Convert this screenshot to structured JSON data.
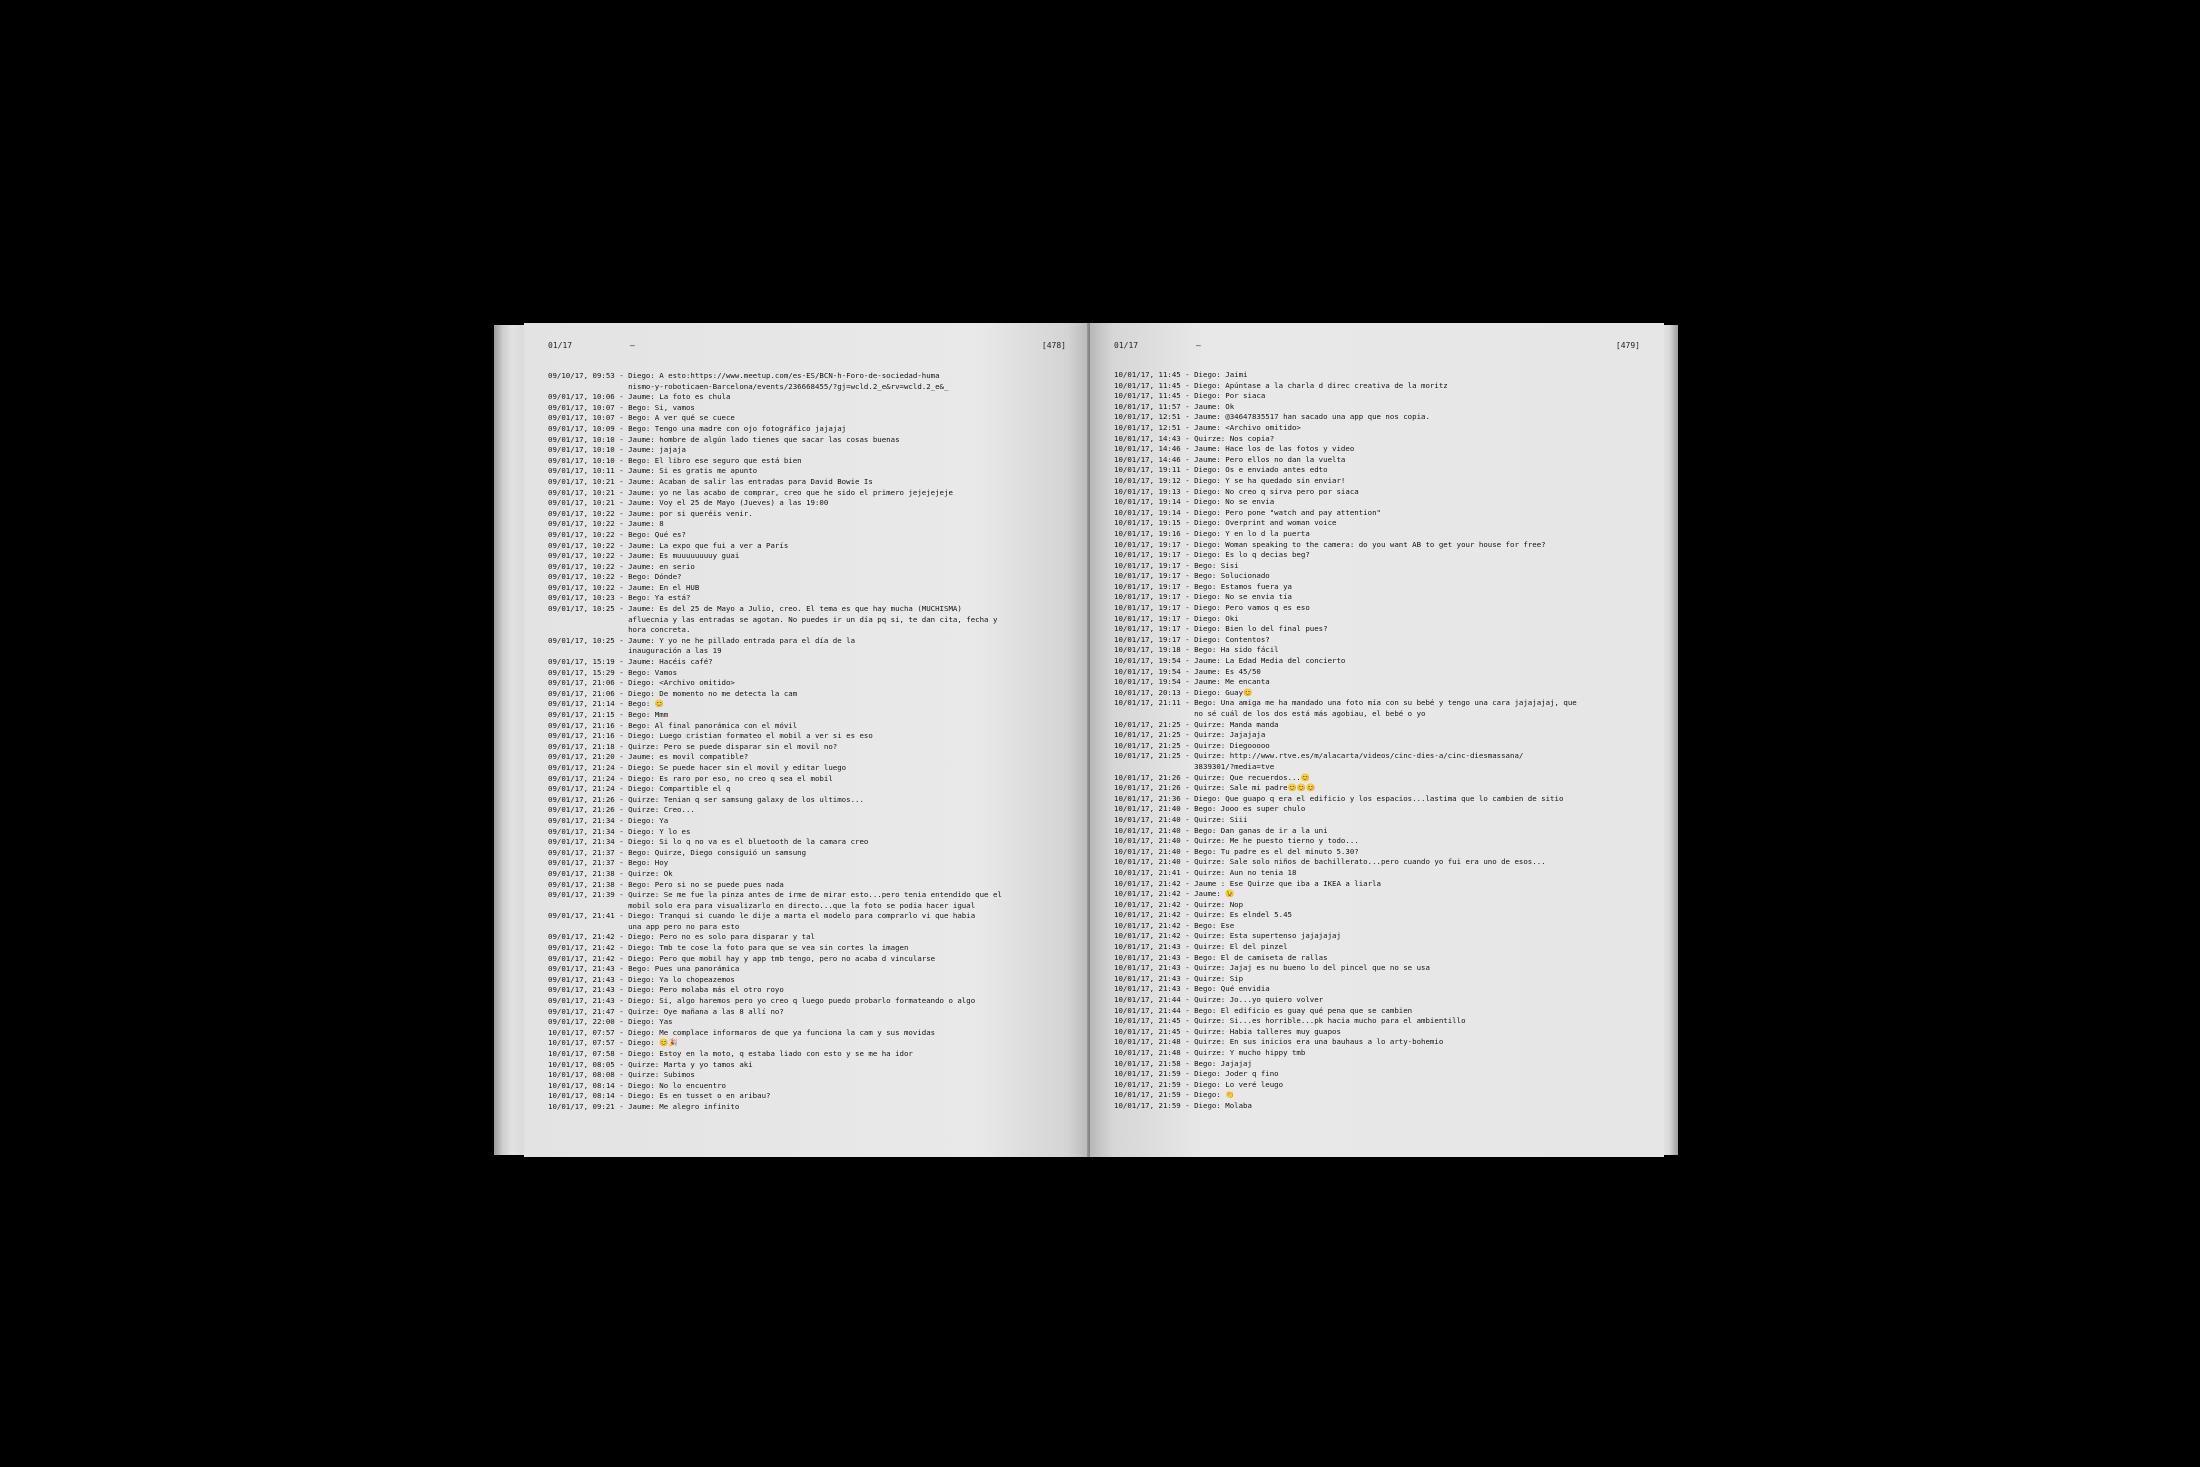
{
  "left_page": {
    "header": {
      "date": "01/17",
      "dash": "–",
      "page_number": "[478]"
    },
    "lines": [
      {
        "ts": "09/10/17, 09:53 - ",
        "msg": "Diego: A esto:https://www.meetup.com/es-ES/BCN-h-Foro-de-sociedad-huma\nnismo-y-roboticaen-Barcelona/events/236668455/?gj=wcld.2_e&rv=wcld.2_e&_"
      },
      {
        "ts": "09/01/17, 10:06 - ",
        "msg": "Jaume: La foto es chula"
      },
      {
        "ts": "09/01/17, 10:07 - ",
        "msg": "Bego: Si, vamos"
      },
      {
        "ts": "09/01/17, 10:07 - ",
        "msg": "Bego: A ver qué se cuece"
      },
      {
        "ts": "09/01/17, 10:09 - ",
        "msg": "Bego: Tengo una madre con ojo fotográfico jajajaj"
      },
      {
        "ts": "09/01/17, 10:10 - ",
        "msg": "Jaume: hombre de algún lado tienes que sacar las cosas buenas"
      },
      {
        "ts": "09/01/17, 10:10 - ",
        "msg": "Jaume: jajaja"
      },
      {
        "ts": "09/01/17, 10:10 - ",
        "msg": "Bego: El libro ese seguro que está bien"
      },
      {
        "ts": "09/01/17, 10:11 - ",
        "msg": "Jaume: Si es gratis me apunto"
      },
      {
        "ts": "09/01/17, 10:21 - ",
        "msg": "Jaume: Acaban de salir las entradas para David Bowie Is"
      },
      {
        "ts": "09/01/17, 10:21 - ",
        "msg": "Jaume: yo ne las acabo de comprar, creo que he sido el primero jejejejeje"
      },
      {
        "ts": "09/01/17, 10:21 - ",
        "msg": "Jaume: Voy el 25 de Mayo (Jueves) a las 19:00"
      },
      {
        "ts": "09/01/17, 10:22 - ",
        "msg": "Jaume: por si queréis venir."
      },
      {
        "ts": "09/01/17, 10:22 - ",
        "msg": "Jaume: 8"
      },
      {
        "ts": "09/01/17, 10:22 - ",
        "msg": "Bego: Qué es?"
      },
      {
        "ts": "09/01/17, 10:22 - ",
        "msg": "Jaume: La expo que fui a ver a París"
      },
      {
        "ts": "09/01/17, 10:22 - ",
        "msg": "Jaume: Es muuuuuuuuy guai"
      },
      {
        "ts": "09/01/17, 10:22 - ",
        "msg": "Jaume: en serio"
      },
      {
        "ts": "09/01/17, 10:22 - ",
        "msg": "Bego: Dónde?"
      },
      {
        "ts": "09/01/17, 10:22 - ",
        "msg": "Jaume: En el HUB"
      },
      {
        "ts": "09/01/17, 10:23 - ",
        "msg": "Bego: Ya está?"
      },
      {
        "ts": "09/01/17, 10:25 - ",
        "msg": "Jaume: Es del 25 de Mayo a Julio, creo. El tema es que hay mucha (MUCHISMA)\nafluecnia y las entradas se agotan. No puedes ir un día pq si, te dan cita, fecha y\nhora concreta."
      },
      {
        "ts": "09/01/17, 10:25 - ",
        "msg": "Jaume: Y yo ne he pillado entrada para el día de la\ninauguración a las 19"
      },
      {
        "ts": "09/01/17, 15:19 - ",
        "msg": "Jaume: Hacéis café?"
      },
      {
        "ts": "09/01/17, 15:29 - ",
        "msg": "Bego: Vamos"
      },
      {
        "ts": "09/01/17, 21:06 - ",
        "msg": "Diego: <Archivo omitido>"
      },
      {
        "ts": "09/01/17, 21:06 - ",
        "msg": "Diego: De momento no me detecta la cam"
      },
      {
        "ts": "09/01/17, 21:14 - ",
        "msg": "Bego: 😊"
      },
      {
        "ts": "09/01/17, 21:15 - ",
        "msg": "Bego: Mmm"
      },
      {
        "ts": "09/01/17, 21:16 - ",
        "msg": "Bego: Al final panorámica con el móvil"
      },
      {
        "ts": "09/01/17, 21:16 - ",
        "msg": "Diego: Luego cristian formateo el mobil a ver si es eso"
      },
      {
        "ts": "09/01/17, 21:18 - ",
        "msg": "Quirze: Pero se puede disparar sin el movil no?"
      },
      {
        "ts": "09/01/17, 21:20 - ",
        "msg": "Jaume: es movil compatible?"
      },
      {
        "ts": "09/01/17, 21:24 - ",
        "msg": "Diego: Se puede hacer sin el movil y editar luego"
      },
      {
        "ts": "09/01/17, 21:24 - ",
        "msg": "Diego: Es raro por eso, no creo q sea el mobil"
      },
      {
        "ts": "09/01/17, 21:24 - ",
        "msg": "Diego: Compartible el q"
      },
      {
        "ts": "09/01/17, 21:26 - ",
        "msg": "Quirze: Tenian q ser samsung galaxy de los ultimos..."
      },
      {
        "ts": "09/01/17, 21:26 - ",
        "msg": "Quirze: Creo..."
      },
      {
        "ts": "09/01/17, 21:34 - ",
        "msg": "Diego: Ya"
      },
      {
        "ts": "09/01/17, 21:34 - ",
        "msg": "Diego: Y lo es"
      },
      {
        "ts": "09/01/17, 21:34 - ",
        "msg": "Diego: Si lo q no va es el bluetooth de la camara creo"
      },
      {
        "ts": "09/01/17, 21:37 - ",
        "msg": "Bego: Quirze, Diego consiguió un samsung"
      },
      {
        "ts": "09/01/17, 21:37 - ",
        "msg": "Bego: Hoy"
      },
      {
        "ts": "09/01/17, 21:38 - ",
        "msg": "Quirze: Ok"
      },
      {
        "ts": "09/01/17, 21:38 - ",
        "msg": "Bego: Pero si no se puede pues nada"
      },
      {
        "ts": "09/01/17, 21:39 - ",
        "msg": "Quirze: Se me fue la pinza antes de irme de mirar esto...pero tenia entendido que el\nmobil solo era para visualizarlo en directo...que la foto se podia hacer igual"
      },
      {
        "ts": "09/01/17, 21:41 - ",
        "msg": "Diego: Tranqui si cuando le dije a marta el modelo para comprarlo vi que habia\nuna app pero no para esto"
      },
      {
        "ts": "09/01/17, 21:42 - ",
        "msg": "Diego: Pero no es solo para disparar y tal"
      },
      {
        "ts": "09/01/17, 21:42 - ",
        "msg": "Diego: Tmb te cose la foto para que se vea sin cortes la imagen"
      },
      {
        "ts": "09/01/17, 21:42 - ",
        "msg": "Diego: Pero que mobil hay y app tmb tengo, pero no acaba d vincularse"
      },
      {
        "ts": "09/01/17, 21:43 - ",
        "msg": "Bego: Pues una panorámica"
      },
      {
        "ts": "09/01/17, 21:43 - ",
        "msg": "Diego: Ya lo chopeazemos"
      },
      {
        "ts": "09/01/17, 21:43 - ",
        "msg": "Diego: Pero molaba más el otro royo"
      },
      {
        "ts": "09/01/17, 21:43 - ",
        "msg": "Diego: Si, algo haremos pero yo creo q luego puedo probarlo formateando o algo"
      },
      {
        "ts": "09/01/17, 21:47 - ",
        "msg": "Quirze: Oye mañana a las 8 allí no?"
      },
      {
        "ts": "09/01/17, 22:00 - ",
        "msg": "Diego: Yas"
      },
      {
        "ts": "10/01/17, 07:57 - ",
        "msg": "Diego: Me complace informaros de que ya funciona la cam y sus movidas"
      },
      {
        "ts": "10/01/17, 07:57 - ",
        "msg": "Diego: 😊🎉"
      },
      {
        "ts": "10/01/17, 07:58 - ",
        "msg": "Diego: Estoy en la moto, q estaba liado con esto y se me ha idor"
      },
      {
        "ts": "10/01/17, 08:05 - ",
        "msg": "Quirze: Marta y yo tamos aki"
      },
      {
        "ts": "10/01/17, 08:08 - ",
        "msg": "Quirze: Subimos"
      },
      {
        "ts": "10/01/17, 08:14 - ",
        "msg": "Diego: No lo encuentro"
      },
      {
        "ts": "10/01/17, 08:14 - ",
        "msg": "Diego: Es en tusset o en aribau?"
      },
      {
        "ts": "10/01/17, 09:21 - ",
        "msg": "Jaume: Me alegro infinito"
      }
    ]
  },
  "right_page": {
    "header": {
      "date": "01/17",
      "dash": "–",
      "page_number": "[479]"
    },
    "lines": [
      {
        "ts": "10/01/17, 11:45 - ",
        "msg": "Diego: Jaimi"
      },
      {
        "ts": "10/01/17, 11:45 - ",
        "msg": "Diego: Apúntase a la charla d direc creativa de la moritz"
      },
      {
        "ts": "10/01/17, 11:45 - ",
        "msg": "Diego: Por siaca"
      },
      {
        "ts": "10/01/17, 11:57 - ",
        "msg": "Jaume: Ok"
      },
      {
        "ts": "10/01/17, 12:51 - ",
        "msg": "Jaume: @34647835517 han sacado una app que nos copia."
      },
      {
        "ts": "10/01/17, 12:51 - ",
        "msg": "Jaume: <Archivo omitido>"
      },
      {
        "ts": "10/01/17, 14:43 - ",
        "msg": "Quirze: Nos copia?"
      },
      {
        "ts": "10/01/17, 14:46 - ",
        "msg": "Jaume: Hace los de las fotos y video"
      },
      {
        "ts": "10/01/17, 14:46 - ",
        "msg": "Jaume: Pero ellos no dan la vuelta"
      },
      {
        "ts": "10/01/17, 19:11 - ",
        "msg": "Diego: Os e enviado antes edto"
      },
      {
        "ts": "10/01/17, 19:12 - ",
        "msg": "Diego: Y se ha quedado sin enviar!"
      },
      {
        "ts": "10/01/17, 19:13 - ",
        "msg": "Diego: No creo q sirva pero por siaca"
      },
      {
        "ts": "10/01/17, 19:14 - ",
        "msg": "Diego: No se envia"
      },
      {
        "ts": "10/01/17, 19:14 - ",
        "msg": "Diego: Pero pone \"watch and pay attention\""
      },
      {
        "ts": "10/01/17, 19:15 - ",
        "msg": "Diego: Overprint and woman voice"
      },
      {
        "ts": "10/01/17, 19:16 - ",
        "msg": "Diego: Y en lo d la puerta"
      },
      {
        "ts": "10/01/17, 19:17 - ",
        "msg": "Diego: Woman speaking to the camera: do you want AB to get your house for free?"
      },
      {
        "ts": "10/01/17, 19:17 - ",
        "msg": "Diego: Es lo q decias beg?"
      },
      {
        "ts": "10/01/17, 19:17 - ",
        "msg": "Bego: Sisi"
      },
      {
        "ts": "10/01/17, 19:17 - ",
        "msg": "Bego: Solucionado"
      },
      {
        "ts": "10/01/17, 19:17 - ",
        "msg": "Bego: Estamos fuera ya"
      },
      {
        "ts": "10/01/17, 19:17 - ",
        "msg": "Diego: No se envia tía"
      },
      {
        "ts": "10/01/17, 19:17 - ",
        "msg": "Diego: Pero vamos q es eso"
      },
      {
        "ts": "10/01/17, 19:17 - ",
        "msg": "Diego: Oki"
      },
      {
        "ts": "10/01/17, 19:17 - ",
        "msg": "Diego: Bien lo del final pues?"
      },
      {
        "ts": "10/01/17, 19:17 - ",
        "msg": "Diego: Contentos?"
      },
      {
        "ts": "10/01/17, 19:18 - ",
        "msg": "Bego: Ha sido fácil"
      },
      {
        "ts": "10/01/17, 19:54 - ",
        "msg": "Jaume: La Edad Media del concierto"
      },
      {
        "ts": "10/01/17, 19:54 - ",
        "msg": "Jaume: Es 45/50"
      },
      {
        "ts": "10/01/17, 19:54 - ",
        "msg": "Jaume: Me encanta"
      },
      {
        "ts": "10/01/17, 20:13 - ",
        "msg": "Diego: Guay😊"
      },
      {
        "ts": "10/01/17, 21:11 - ",
        "msg": "Bego: Una amiga me ha mandado una foto mía con su bebé y tengo una cara jajajajaj, que\nno sé cuál de los dos está más agobiau, el bebé o yo"
      },
      {
        "ts": "10/01/17, 21:25 - ",
        "msg": "Quirze: Manda manda"
      },
      {
        "ts": "10/01/17, 21:25 - ",
        "msg": "Quirze: Jajajaja"
      },
      {
        "ts": "10/01/17, 21:25 - ",
        "msg": "Quirze: Diegooooo"
      },
      {
        "ts": "10/01/17, 21:25 - ",
        "msg": "Quirze: http://www.rtve.es/m/alacarta/videos/cinc-dies-a/cinc-diesmassana/\n3839301/?media=tve"
      },
      {
        "ts": "10/01/17, 21:26 - ",
        "msg": "Quirze: Que recuerdos...😊"
      },
      {
        "ts": "10/01/17, 21:26 - ",
        "msg": "Quirze: Sale mi padre😊😊😊"
      },
      {
        "ts": "10/01/17, 21:36 - ",
        "msg": "Diego: Que guapo q era el edificio y los espacios...lastima que lo cambien de sitio"
      },
      {
        "ts": "10/01/17, 21:40 - ",
        "msg": "Bego: Jooo es super chulo"
      },
      {
        "ts": "10/01/17, 21:40 - ",
        "msg": "Quirze: Siii"
      },
      {
        "ts": "10/01/17, 21:40 - ",
        "msg": "Bego: Dan ganas de ir a la uni"
      },
      {
        "ts": "10/01/17, 21:40 - ",
        "msg": "Quirze: Me he puesto tierno y todo..."
      },
      {
        "ts": "10/01/17, 21:40 - ",
        "msg": "Bego: Tu padre es el del minuto 5.30?"
      },
      {
        "ts": "10/01/17, 21:40 - ",
        "msg": "Quirze: Sale solo niños de bachillerato...pero cuando yo fui era uno de esos..."
      },
      {
        "ts": "10/01/17, 21:41 - ",
        "msg": "Quirze: Aun no tenia 18"
      },
      {
        "ts": "10/01/17, 21:42 - ",
        "msg": "Jaume : Ese Quirze que iba a IKEA a liarla"
      },
      {
        "ts": "10/01/17, 21:42 - ",
        "msg": "Jaume: 😉"
      },
      {
        "ts": "10/01/17, 21:42 - ",
        "msg": "Quirze: Nop"
      },
      {
        "ts": "10/01/17, 21:42 - ",
        "msg": "Quirze: Es elndel 5.45"
      },
      {
        "ts": "10/01/17, 21:42 - ",
        "msg": "Bego: Ese"
      },
      {
        "ts": "10/01/17, 21:42 - ",
        "msg": "Quirze: Esta supertenso jajajajaj"
      },
      {
        "ts": "10/01/17, 21:43 - ",
        "msg": "Quirze: El del pinzel"
      },
      {
        "ts": "10/01/17, 21:43 - ",
        "msg": "Bego: El de camiseta de rallas"
      },
      {
        "ts": "10/01/17, 21:43 - ",
        "msg": "Quirze: Jajaj es nu bueno lo del pincel que no se usa"
      },
      {
        "ts": "10/01/17, 21:43 - ",
        "msg": "Quirze: Sip"
      },
      {
        "ts": "10/01/17, 21:43 - ",
        "msg": "Bego: Qué envidia"
      },
      {
        "ts": "10/01/17, 21:44 - ",
        "msg": "Quirze: Jo...yo quiero volver"
      },
      {
        "ts": "10/01/17, 21:44 - ",
        "msg": "Bego: El edificio es guay qué pena que se cambien"
      },
      {
        "ts": "10/01/17, 21:45 - ",
        "msg": "Quirze: Si...es horrible...pk hacia mucho para el ambientillo"
      },
      {
        "ts": "10/01/17, 21:45 - ",
        "msg": "Quirze: Habia talleres muy guapos"
      },
      {
        "ts": "10/01/17, 21:48 - ",
        "msg": "Quirze: En sus inicios era una bauhaus a lo arty-bohemio"
      },
      {
        "ts": "10/01/17, 21:48 - ",
        "msg": "Quirze: Y mucho hippy tmb"
      },
      {
        "ts": "10/01/17, 21:58 - ",
        "msg": "Bego: Jajajaj"
      },
      {
        "ts": "10/01/17, 21:59 - ",
        "msg": "Diego: Joder q fino"
      },
      {
        "ts": "10/01/17, 21:59 - ",
        "msg": "Diego: Lo veré leugo"
      },
      {
        "ts": "10/01/17, 21:59 - ",
        "msg": "Diego: 👏"
      },
      {
        "ts": "10/01/17, 21:59 - ",
        "msg": "Diego: Molaba"
      }
    ]
  }
}
